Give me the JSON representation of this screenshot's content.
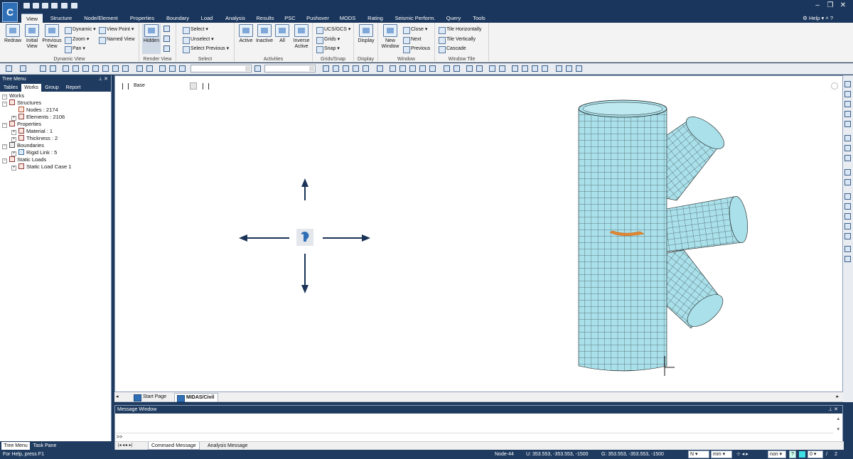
{
  "app": {
    "logo": "C",
    "help_label": "Help"
  },
  "menu": [
    "View",
    "Structure",
    "Node/Element",
    "Properties",
    "Boundary",
    "Load",
    "Analysis",
    "Results",
    "PSC",
    "Pushover",
    "MODS",
    "Rating",
    "Seismic Perform.",
    "Query",
    "Tools"
  ],
  "ribbon": {
    "dynamic_view": {
      "label": "Dynamic View",
      "redraw": "Redraw",
      "initial_view": "Initial View",
      "previous_view": "Previous View",
      "dynamic": "Dynamic",
      "zoom": "Zoom",
      "pan": "Pan",
      "view_point": "View Point",
      "named_view": "Named View"
    },
    "render_view": {
      "label": "Render View",
      "hidden": "Hidden"
    },
    "select": {
      "label": "Select",
      "select": "Select",
      "unselect": "Unselect",
      "select_previous": "Select Previous"
    },
    "activities": {
      "label": "Activities",
      "active": "Active",
      "inactive": "Inactive",
      "all": "All",
      "inverse_active": "Inverse Active"
    },
    "grids_snap": {
      "label": "Grids/Snap",
      "ucs_gcs": "UCS/GCS",
      "grids": "Grids",
      "snap": "Snap"
    },
    "display": {
      "label": "Display",
      "display": "Display"
    },
    "window": {
      "label": "Window",
      "new_window": "New Window",
      "close": "Close",
      "next": "Next",
      "previous": "Previous"
    },
    "window_tile": {
      "label": "Window Tile",
      "tile_horizontally": "Tile Horizontally",
      "tile_vertically": "Tile Vertically",
      "cascade": "Cascade"
    }
  },
  "tree": {
    "title": "Tree Menu",
    "tabs": [
      "Tables",
      "Works",
      "Group",
      "Report"
    ],
    "nodes": [
      {
        "label": "Works",
        "level": 0
      },
      {
        "label": "Structures",
        "level": 1
      },
      {
        "label": "Nodes : 2174",
        "level": 2
      },
      {
        "label": "Elements : 2106",
        "level": 2
      },
      {
        "label": "Properties",
        "level": 1
      },
      {
        "label": "Material : 1",
        "level": 2
      },
      {
        "label": "Thickness : 2",
        "level": 2
      },
      {
        "label": "Boundaries",
        "level": 1
      },
      {
        "label": "Rigid Link : 5",
        "level": 2
      },
      {
        "label": "Static Loads",
        "level": 1
      },
      {
        "label": "Static Load Case 1",
        "level": 2
      }
    ],
    "bottom_tabs": [
      "Tree Menu",
      "Task Pane"
    ]
  },
  "viewport": {
    "base_label": "Base"
  },
  "view_tabs": [
    "Start Page",
    "MIDAS/Civil"
  ],
  "message": {
    "title": "Message Window",
    "prompt": ">>",
    "tabs": [
      "Command Message",
      "Analysis Message"
    ]
  },
  "status": {
    "help": "For Help, press F1",
    "node": "Node-44",
    "u_coord": "U: 353.553, -353.553, -1500",
    "g_coord": "G: 353.553, -353.553, -1500",
    "unit_force": "N",
    "unit_length": "mm",
    "non": "non",
    "page_value": "0",
    "page_total": "2"
  },
  "colors": {
    "mesh_fill": "#a9e0ea",
    "mesh_line": "#1a1a1a",
    "arrow": "#1b3357",
    "chrome": "#1f3b60"
  }
}
